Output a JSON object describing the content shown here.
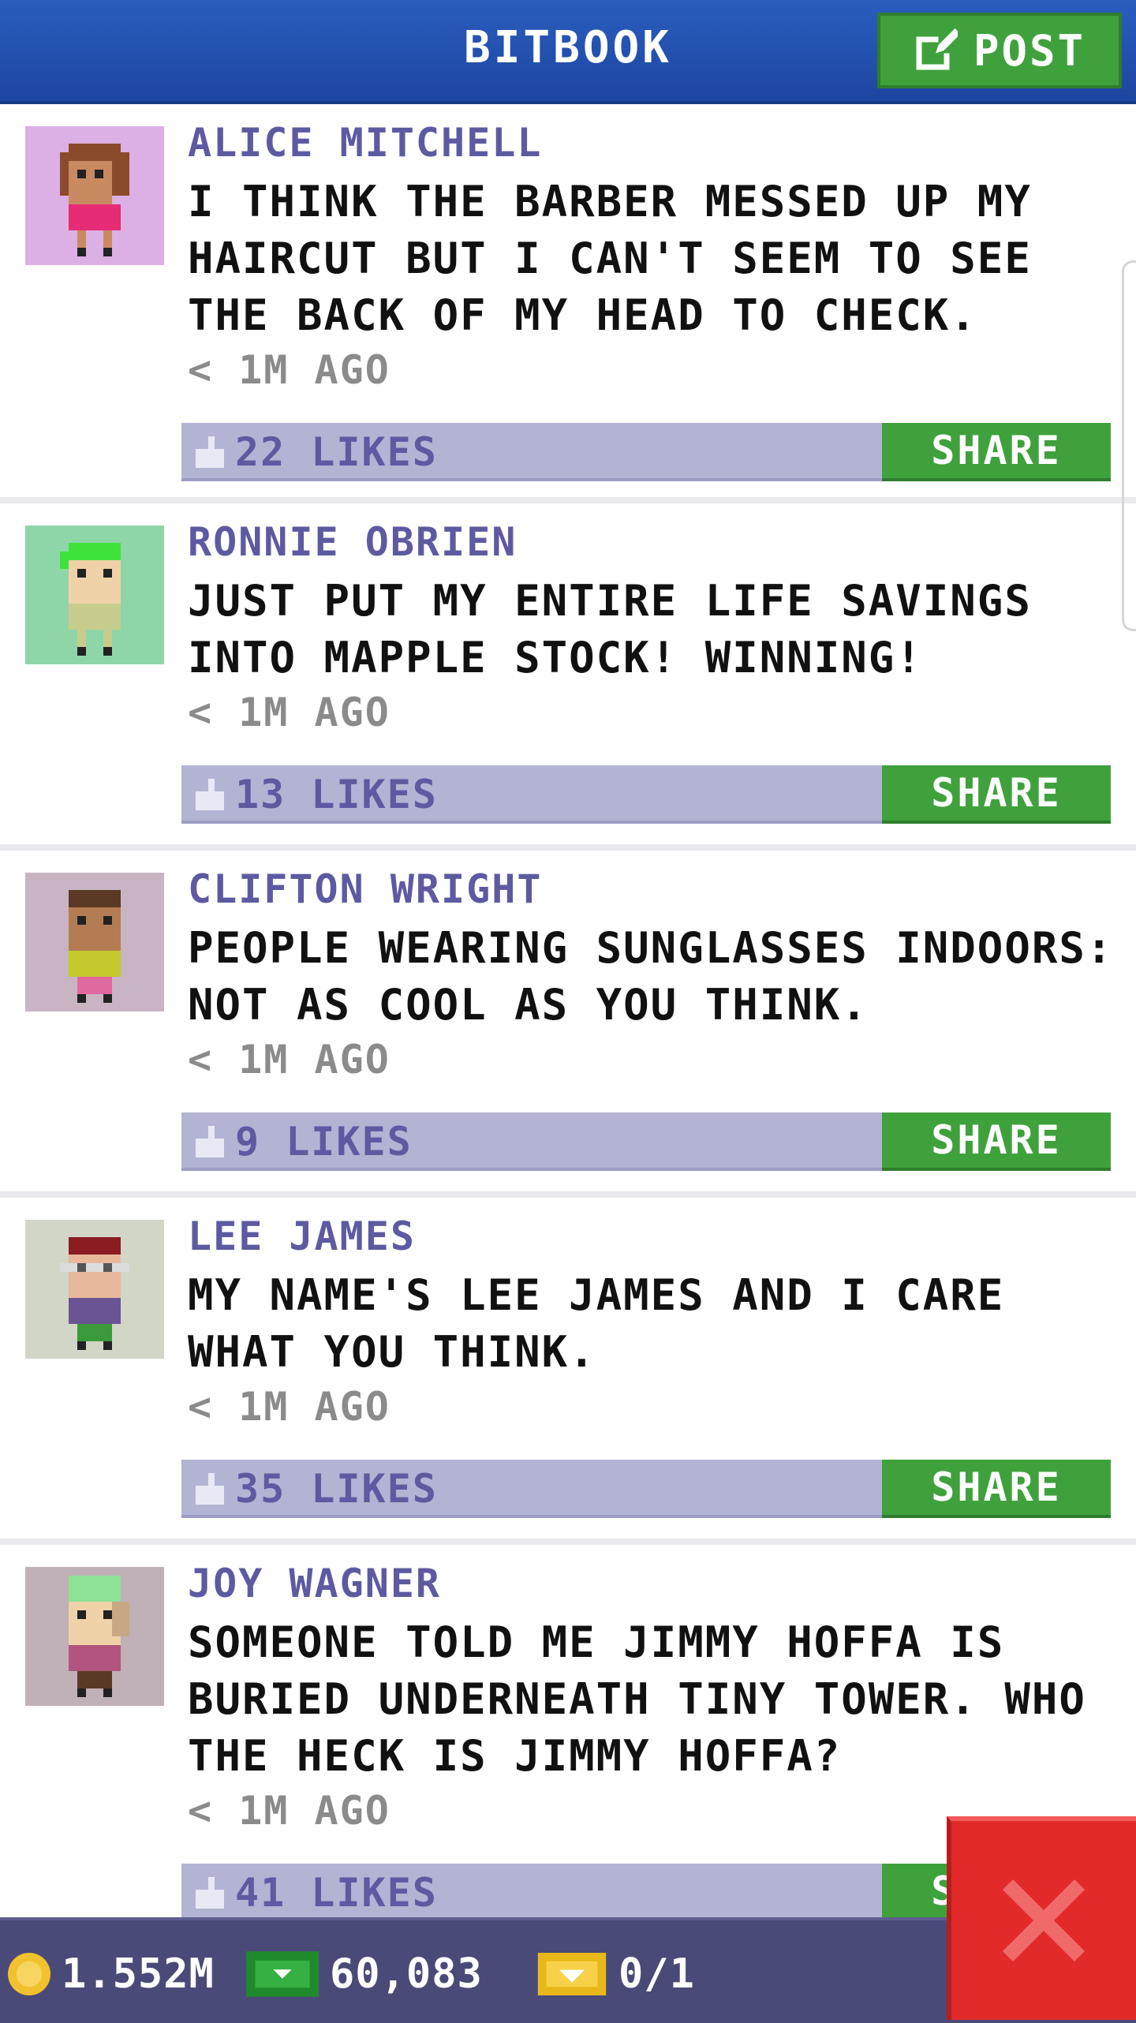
{
  "header": {
    "title": "BITBOOK",
    "post_label": "POST"
  },
  "posts": [
    {
      "name": "ALICE MITCHELL",
      "text": "I THINK THE BARBER MESSED UP MY HAIRCUT BUT I CAN'T SEEM TO SEE THE BACK OF MY HEAD TO CHECK.",
      "time": "< 1M AGO",
      "likes": "22 LIKES",
      "share_label": "SHARE",
      "avatar": {
        "bg": "#dcb0e4",
        "hair": "#8b4a2b",
        "skin": "#c98a62",
        "shirt": "#e52c74",
        "legs": "#c98a62"
      }
    },
    {
      "name": "RONNIE OBRIEN",
      "text": "JUST PUT MY ENTIRE LIFE SAVINGS INTO MAPPLE STOCK! WINNING!",
      "time": "< 1M AGO",
      "likes": "13 LIKES",
      "share_label": "SHARE",
      "avatar": {
        "bg": "#8ed6a7",
        "hair": "#3ee23a",
        "skin": "#f0d2a8",
        "shirt": "#c8cc8c",
        "legs": "#c8cc8c"
      }
    },
    {
      "name": "CLIFTON WRIGHT",
      "text": "PEOPLE WEARING SUNGLASSES INDOORS: NOT AS COOL AS YOU THINK.",
      "time": "< 1M AGO",
      "likes": "9 LIKES",
      "share_label": "SHARE",
      "avatar": {
        "bg": "#c9b4c4",
        "hair": "#5a3a24",
        "skin": "#b47c52",
        "shirt": "#c4c82c",
        "legs": "#e06aa0"
      }
    },
    {
      "name": "LEE JAMES",
      "text": "MY NAME'S LEE JAMES AND I CARE WHAT YOU THINK.",
      "time": "< 1M AGO",
      "likes": "35 LIKES",
      "share_label": "SHARE",
      "avatar": {
        "bg": "#d1d6c6",
        "hair": "#8a1c22",
        "skin": "#e8b89c",
        "shirt": "#6a5494",
        "legs": "#3a9a3a"
      }
    },
    {
      "name": "JOY WAGNER",
      "text": "SOMEONE TOLD ME JIMMY HOFFA IS BURIED UNDERNEATH TINY TOWER. WHO THE HECK IS JIMMY HOFFA?",
      "time": "< 1M AGO",
      "likes": "41 LIKES",
      "share_label": "SHARE",
      "avatar": {
        "bg": "#c0b0b8",
        "hair": "#8ee296",
        "skin": "#f0d2a8",
        "shirt": "#b2547e",
        "legs": "#5a3a24"
      }
    }
  ],
  "footer": {
    "coins": "1.552M",
    "bux": "60,083",
    "tickets": "0/1"
  },
  "colors": {
    "accent_green": "#3fa13c",
    "header_blue": "#2a5dbf",
    "name_purple": "#5d5aa2",
    "close_red": "#e22a2a"
  }
}
